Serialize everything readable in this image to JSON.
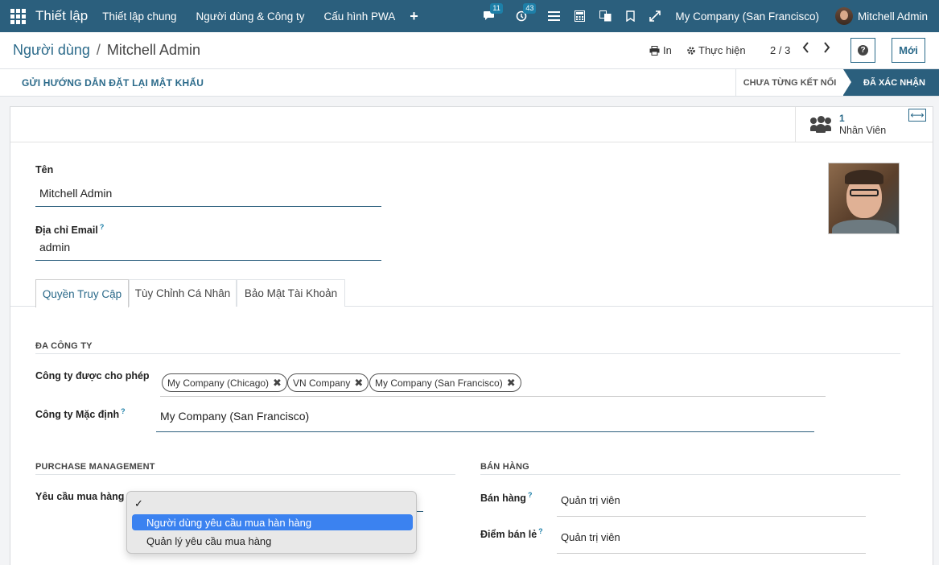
{
  "navbar": {
    "brand": "Thiết lập",
    "menu": [
      "Thiết lập chung",
      "Người dùng & Công ty",
      "Cấu hình PWA"
    ],
    "plus": "+",
    "chat_badge": "11",
    "activity_badge": "43",
    "company": "My Company (San Francisco)",
    "user": "Mitchell Admin"
  },
  "control": {
    "breadcrumb_parent": "Người dùng",
    "breadcrumb_sep": "/",
    "breadcrumb_current": "Mitchell Admin",
    "print_label": "In",
    "action_label": "Thực hiện",
    "pager": "2 / 3",
    "new_label": "Mới"
  },
  "status": {
    "reset_button": "GỬI HƯỚNG DẪN ĐẶT LẠI MẬT KHẨU",
    "stage_never": "CHƯA TỪNG KẾT NỐI",
    "stage_confirmed": "ĐÃ XÁC NHẬN"
  },
  "smart_button": {
    "count": "1",
    "label": "Nhân Viên"
  },
  "form": {
    "name_label": "Tên",
    "name_value": "Mitchell Admin",
    "email_label": "Địa chỉ Email",
    "email_value": "admin"
  },
  "tabs": [
    "Quyền Truy Cập",
    "Tùy Chỉnh Cá Nhân",
    "Bảo Mật Tài Khoản"
  ],
  "multi_company": {
    "title": "ĐA CÔNG TY",
    "allowed_label": "Công ty được cho phép",
    "allowed_tags": [
      "My Company (Chicago)",
      "VN Company",
      "My Company (San Francisco)"
    ],
    "default_label": "Công ty Mặc định",
    "default_value": "My Company (San Francisco)"
  },
  "purchase": {
    "title": "PURCHASE MANAGEMENT",
    "request_label": "Yêu cầu mua hàng"
  },
  "sales": {
    "title": "BÁN HÀNG",
    "sales_label": "Bán hàng",
    "sales_value": "Quản trị viên",
    "pos_label": "Điểm bán lẻ",
    "pos_value": "Quản trị viên"
  },
  "dropdown": {
    "check": "✓",
    "options": [
      "Người dùng yêu cầu mua hàn hàng",
      "Quản lý yêu cầu mua hàng"
    ]
  },
  "help_mark": "?",
  "tooltip_mark": "?",
  "tag_remove": "✖"
}
